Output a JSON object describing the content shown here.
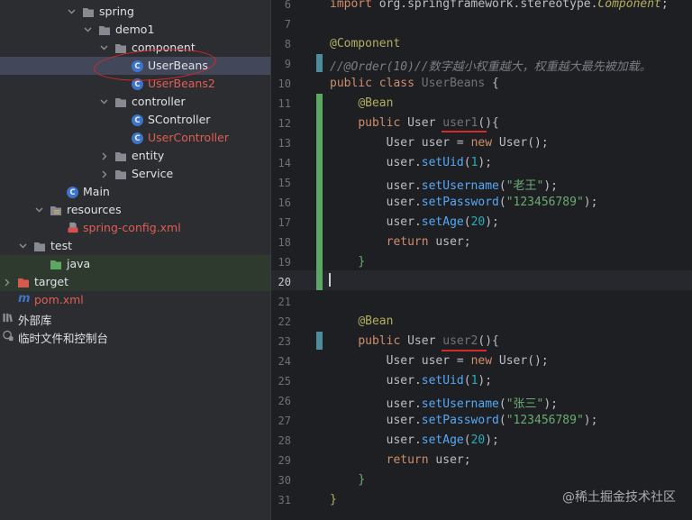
{
  "tree": {
    "items": [
      {
        "label": "spring",
        "kind": "folder"
      },
      {
        "label": "demo1",
        "kind": "folder"
      },
      {
        "label": "component",
        "kind": "folder"
      },
      {
        "label": "UserBeans",
        "kind": "class",
        "selected": true
      },
      {
        "label": "UserBeans2",
        "kind": "class"
      },
      {
        "label": "controller",
        "kind": "folder"
      },
      {
        "label": "SController",
        "kind": "class"
      },
      {
        "label": "UserController",
        "kind": "class"
      },
      {
        "label": "entity",
        "kind": "folder"
      },
      {
        "label": "Service",
        "kind": "folder"
      },
      {
        "label": "Main",
        "kind": "class"
      },
      {
        "label": "resources",
        "kind": "folder"
      },
      {
        "label": "spring-config.xml",
        "kind": "xml"
      },
      {
        "label": "test",
        "kind": "folder"
      },
      {
        "label": "java",
        "kind": "folder"
      },
      {
        "label": "target",
        "kind": "folder"
      },
      {
        "label": "pom.xml",
        "kind": "maven"
      },
      {
        "label": "外部库",
        "kind": "library"
      },
      {
        "label": "临时文件和控制台",
        "kind": "scratch"
      }
    ],
    "class_icon_letter": "C"
  },
  "editor": {
    "line_numbers": [
      "6",
      "7",
      "8",
      "9",
      "10",
      "11",
      "12",
      "13",
      "14",
      "15",
      "16",
      "17",
      "18",
      "19",
      "20",
      "21",
      "22",
      "23",
      "24",
      "25",
      "26",
      "27",
      "28",
      "29",
      "30",
      "31"
    ],
    "current_line": "20",
    "tokens": {
      "import": "import",
      "import_path": "org.springframework.stereotype.",
      "import_class": "Component",
      "semicolon": ";",
      "ann_component": "@Component",
      "comment": "//@Order(10)//数字越小权重越大，权重越大最先被加载。",
      "public": "public",
      "class": "class",
      "class_name": "UserBeans",
      "open_brace": "{",
      "close_brace": "}",
      "ann_bean": "@Bean",
      "type_user": "User",
      "method1": "user1",
      "method2": "user2",
      "parens_open": "(){",
      "var_user": "user",
      "assign": " = ",
      "new": "new",
      "ctor": "User",
      "ctor_end": "();",
      "set_uid": "setUid",
      "set_username": "setUsername",
      "set_password": "setPassword",
      "set_age": "setAge",
      "uid_value": "1",
      "username1": "\"老王\"",
      "username2": "\"张三\"",
      "password": "\"123456789\"",
      "age": "20",
      "return": "return",
      "dot": ".",
      "lparen": "(",
      "rparen_semi": ");",
      "ret_end": " user;"
    }
  },
  "watermark": "@稀土掘金技术社区",
  "colors": {
    "annotation_red": "#d32a2a",
    "selection": "#43475a",
    "change_green": "#5aa862"
  }
}
